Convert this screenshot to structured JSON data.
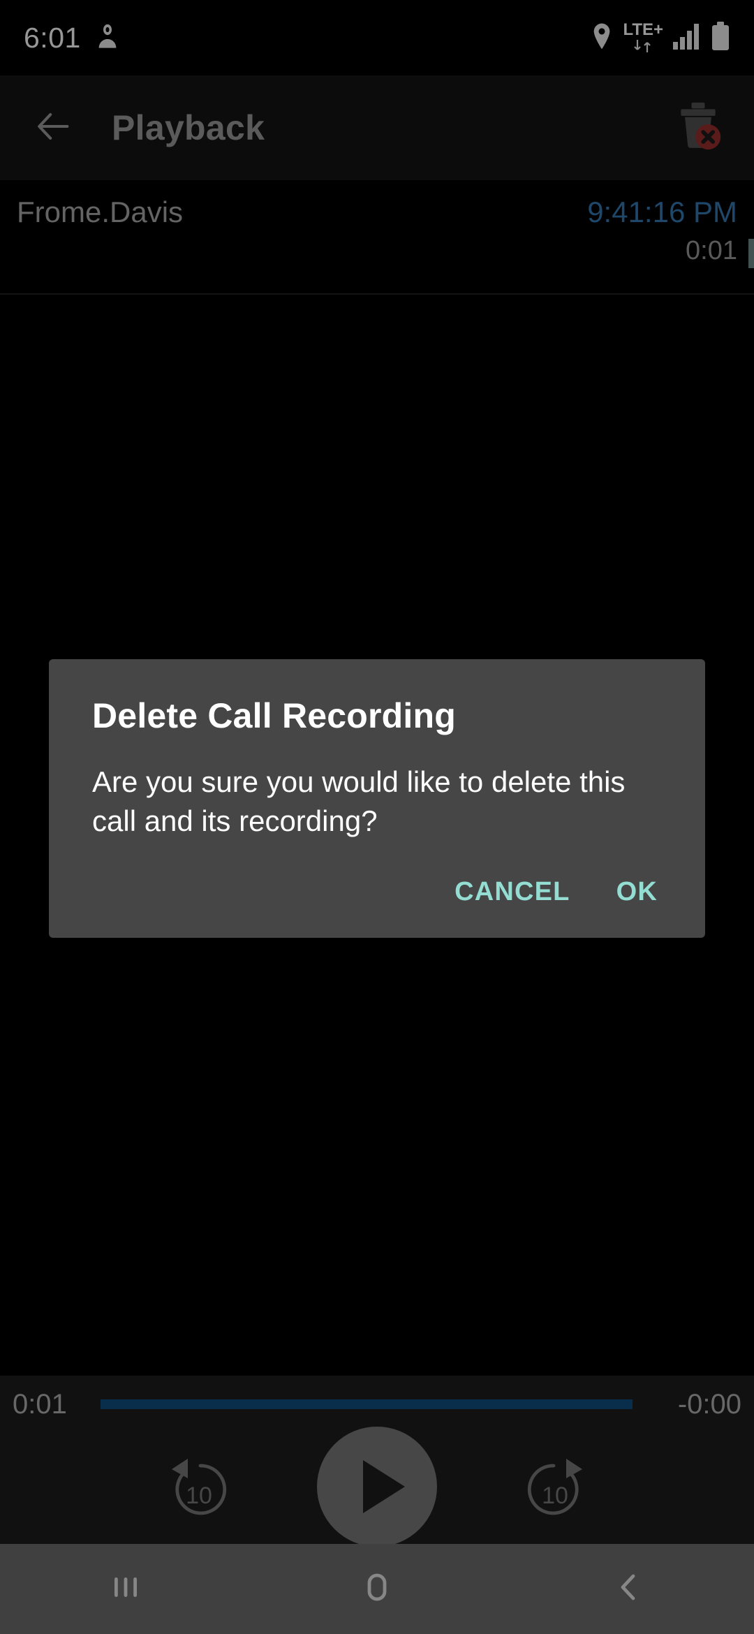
{
  "status_bar": {
    "clock": "6:01",
    "icons": [
      {
        "name": "contacts-icon"
      },
      {
        "name": "location-icon"
      },
      {
        "name": "lte-plus-icon",
        "label": "LTE+"
      },
      {
        "name": "data-transfer-icon"
      },
      {
        "name": "signal-bars-icon"
      },
      {
        "name": "battery-icon"
      }
    ]
  },
  "app_bar": {
    "title": "Playback",
    "back_icon": "arrow-left-icon",
    "delete_icon": "delete-recording-icon"
  },
  "call_info": {
    "contact_name": "Frome.Davis",
    "call_time": "9:41:16 PM",
    "duration": "0:01"
  },
  "dialog": {
    "title": "Delete Call Recording",
    "message": "Are you sure you would like to delete this call and its recording?",
    "cancel_label": "CANCEL",
    "ok_label": "OK"
  },
  "player": {
    "elapsed": "0:01",
    "remaining": "-0:00",
    "progress_percent": 100,
    "rewind_label": "10",
    "forward_label": "10",
    "play_icon": "play-icon",
    "rewind_icon": "rewind-10-icon",
    "forward_icon": "forward-10-icon"
  },
  "nav_bar": {
    "recents_icon": "recents-icon",
    "home_icon": "home-icon",
    "back_icon": "nav-back-icon"
  },
  "colors": {
    "accent_teal": "#93ddd3",
    "call_time_blue": "#2e6da4",
    "progress_blue": "#0e4775",
    "dialog_bg": "#464646",
    "delete_badge_red": "#8b2a2a"
  }
}
